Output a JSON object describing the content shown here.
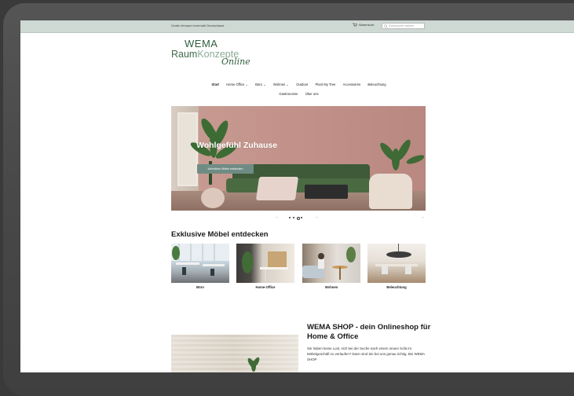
{
  "topbar": {
    "shipping": "Gratis Versand innerhalb Deutschland",
    "cart_label": "Warenkorb",
    "search_placeholder": "Durchsuche unseren"
  },
  "logo": {
    "line1": "WEMA",
    "raum": "Raum",
    "konzepte": "Konzepte",
    "online": "Online"
  },
  "nav": {
    "items": [
      "Start",
      "Home Office ⌄",
      "Büro ⌄",
      "Wohnen ⌄",
      "Outdoor",
      "Plant My Tree",
      "Accessoires",
      "Beleuchtung",
      "Gastronomie",
      "Über uns"
    ]
  },
  "hero": {
    "title": "Wohlgefühl Zuhause",
    "button": "Wohnliche Möbel entdecken"
  },
  "slider": {
    "prev": "‹",
    "next": "›",
    "last": "›"
  },
  "section": {
    "title": "Exklusive Möbel entdecken"
  },
  "categories": [
    {
      "label": "Büro"
    },
    {
      "label": "Home-Office"
    },
    {
      "label": "Wohnen"
    },
    {
      "label": "Beleuchtung"
    }
  ],
  "about": {
    "title": "WEMA SHOP - dein Onlineshop für Home & Office",
    "text": "Sie haben keine Lust, sich bei der Suche nach einem neuen Sofa im Möbelgeschäft zu verlaufen? Dann sind Sie bei uns genau richtig. Bei WEMA SHOP"
  },
  "colors": {
    "topbar": "#cfd9d3",
    "brand_green": "#2e5e3e",
    "hero_button": "#6f8c84"
  }
}
